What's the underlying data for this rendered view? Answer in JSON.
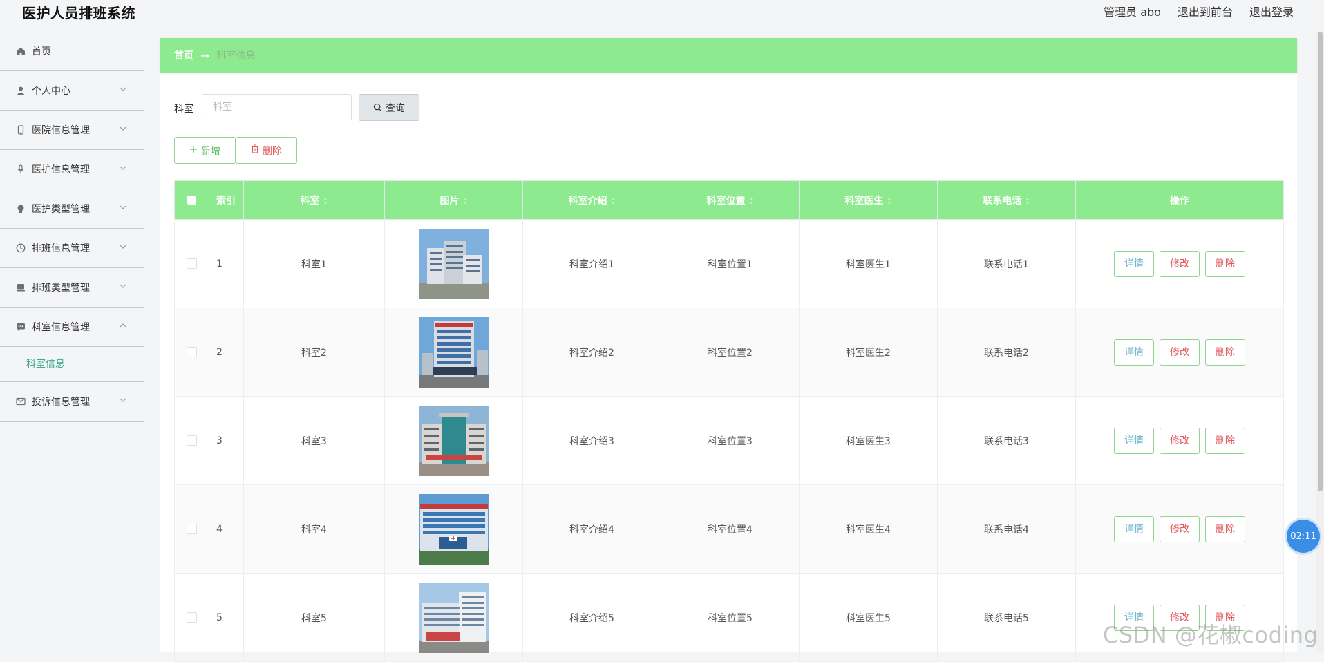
{
  "app": {
    "title": "医护人员排班系统"
  },
  "top_links": {
    "user": "管理员 abo",
    "front": "退出到前台",
    "logout": "退出登录"
  },
  "sidebar": {
    "items": [
      {
        "label": "首页",
        "icon": "home-icon",
        "expandable": false
      },
      {
        "label": "个人中心",
        "icon": "user-icon",
        "expandable": true
      },
      {
        "label": "医院信息管理",
        "icon": "phone-icon",
        "expandable": true
      },
      {
        "label": "医护信息管理",
        "icon": "microphone-icon",
        "expandable": true
      },
      {
        "label": "医护类型管理",
        "icon": "bulb-icon",
        "expandable": true
      },
      {
        "label": "排班信息管理",
        "icon": "clock-icon",
        "expandable": true
      },
      {
        "label": "排班类型管理",
        "icon": "laptop-icon",
        "expandable": true
      },
      {
        "label": "科室信息管理",
        "icon": "chat-icon",
        "expandable": true,
        "expanded": true,
        "sub": [
          "科室信息"
        ]
      },
      {
        "label": "投诉信息管理",
        "icon": "mail-icon",
        "expandable": true
      }
    ]
  },
  "breadcrumb": {
    "home": "首页",
    "separator": "→",
    "current": "科室信息"
  },
  "search": {
    "label": "科室",
    "placeholder": "科室",
    "value": "",
    "button": "查询"
  },
  "actions": {
    "add": "新增",
    "delete": "删除"
  },
  "table": {
    "headers": {
      "index": "索引",
      "keshi": "科室",
      "image": "图片",
      "intro": "科室介绍",
      "location": "科室位置",
      "doctor": "科室医生",
      "phone": "联系电话",
      "ops": "操作"
    },
    "op_labels": {
      "detail": "详情",
      "edit": "修改",
      "delete": "删除"
    },
    "rows": [
      {
        "index": "1",
        "keshi": "科室1",
        "intro": "科室介绍1",
        "location": "科室位置1",
        "doctor": "科室医生1",
        "phone": "联系电话1"
      },
      {
        "index": "2",
        "keshi": "科室2",
        "intro": "科室介绍2",
        "location": "科室位置2",
        "doctor": "科室医生2",
        "phone": "联系电话2"
      },
      {
        "index": "3",
        "keshi": "科室3",
        "intro": "科室介绍3",
        "location": "科室位置3",
        "doctor": "科室医生3",
        "phone": "联系电话3"
      },
      {
        "index": "4",
        "keshi": "科室4",
        "intro": "科室介绍4",
        "location": "科室位置4",
        "doctor": "科室医生4",
        "phone": "联系电话4"
      },
      {
        "index": "5",
        "keshi": "科室5",
        "intro": "科室介绍5",
        "location": "科室位置5",
        "doctor": "科室医生5",
        "phone": "联系电话5"
      }
    ]
  },
  "timer": "02:11",
  "watermark": "CSDN @花椒coding",
  "colors": {
    "accent_green": "#8eea8e",
    "sub_active": "#3fa98e",
    "danger": "#e05a5a",
    "info": "#6cb5c9"
  }
}
